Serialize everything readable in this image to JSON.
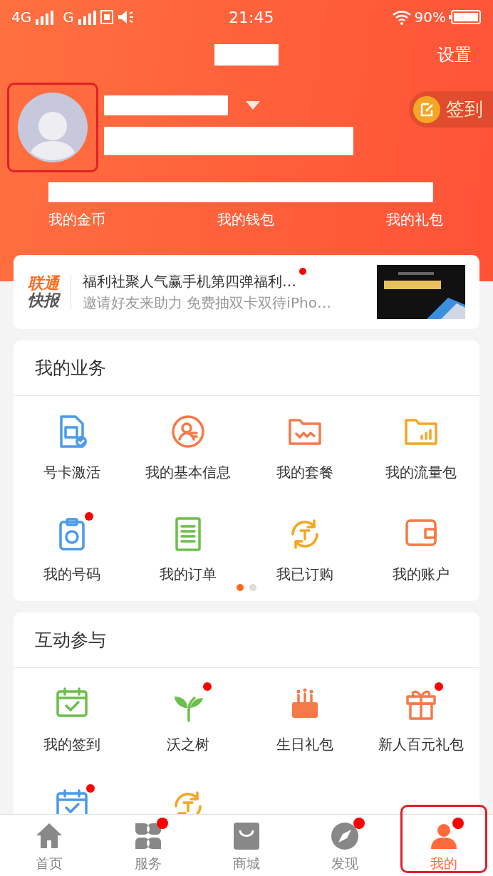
{
  "status_bar": {
    "network_1": "4G",
    "network_2": "G",
    "time": "21:45",
    "battery": "90%"
  },
  "header": {
    "settings": "设置",
    "sign_in": "签到"
  },
  "profile_links": [
    "我的金币",
    "我的钱包",
    "我的礼包"
  ],
  "news": {
    "logo_top": "联通",
    "logo_bottom": "快报",
    "title": "福利社聚人气赢手机第四弹福利…",
    "subtitle": "邀请好友来助力 免费抽双卡双待iPho…",
    "unread": true
  },
  "business": {
    "title": "我的业务",
    "items": [
      {
        "label": "号卡激活",
        "kind": "simcard",
        "color": "#4a9be8",
        "dot": false
      },
      {
        "label": "我的基本信息",
        "kind": "person",
        "color": "#f47a4a",
        "dot": false
      },
      {
        "label": "我的套餐",
        "kind": "folder",
        "color": "#f47a4a",
        "dot": false
      },
      {
        "label": "我的流量包",
        "kind": "chartfolder",
        "color": "#f5a623",
        "dot": false
      },
      {
        "label": "我的号码",
        "kind": "clipboard",
        "color": "#4a9be8",
        "dot": true
      },
      {
        "label": "我的订单",
        "kind": "document",
        "color": "#6cbf4a",
        "dot": false
      },
      {
        "label": "我已订购",
        "kind": "refresh",
        "color": "#f5a623",
        "dot": false
      },
      {
        "label": "我的账户",
        "kind": "wallet",
        "color": "#f47a4a",
        "dot": false
      }
    ],
    "pages": [
      {
        "selected": true
      },
      {
        "selected": false
      }
    ]
  },
  "interactive": {
    "title": "互动参与",
    "items": [
      {
        "label": "我的签到",
        "kind": "calendar",
        "color": "#6cbf4a",
        "dot": false
      },
      {
        "label": "沃之树",
        "kind": "plant",
        "color": "#6cbf4a",
        "dot": true
      },
      {
        "label": "生日礼包",
        "kind": "cake",
        "color": "#f47a4a",
        "dot": false
      },
      {
        "label": "新人百元礼包",
        "kind": "gift",
        "color": "#f47a4a",
        "dot": true
      },
      {
        "kind": "calendar",
        "color": "#4a9be8",
        "dot": true
      },
      {
        "kind": "refresh",
        "color": "#f5a623",
        "dot": false
      }
    ]
  },
  "tabs": [
    {
      "label": "首页",
      "kind": "home",
      "selected": false,
      "dot": false
    },
    {
      "label": "服务",
      "kind": "clover",
      "selected": false,
      "dot": true
    },
    {
      "label": "商城",
      "kind": "bag",
      "selected": false,
      "dot": false
    },
    {
      "label": "发现",
      "kind": "compass",
      "selected": false,
      "dot": true
    },
    {
      "label": "我的",
      "kind": "user",
      "selected": true,
      "dot": true
    }
  ]
}
